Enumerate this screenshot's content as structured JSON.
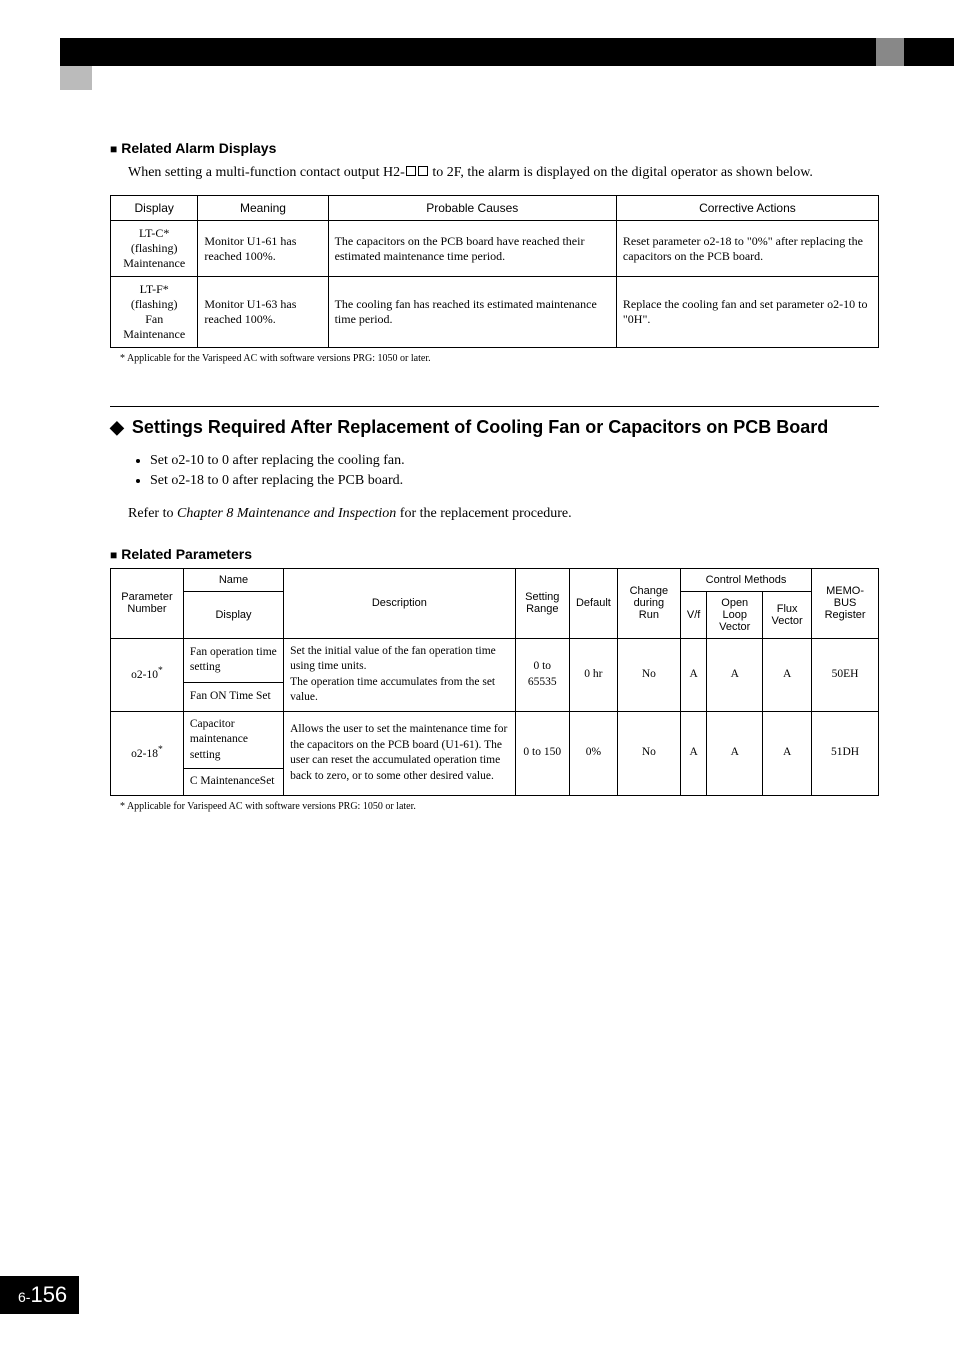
{
  "section1": {
    "heading": "Related Alarm Displays",
    "intro_a": "When setting a multi-function contact output H2-",
    "intro_b": " to 2F, the alarm is displayed on the digital operator as shown below.",
    "table": {
      "headers": [
        "Display",
        "Meaning",
        "Probable Causes",
        "Corrective Actions"
      ],
      "rows": [
        {
          "display_l1": "LT-C*",
          "display_l2": "(flashing)",
          "display_l3": "Maintenance",
          "meaning": "Monitor U1-61 has reached 100%.",
          "causes": "The capacitors on the PCB board have reached their estimated maintenance time period.",
          "actions": "Reset parameter o2-18 to \"0%\" after replacing the capacitors on the PCB board."
        },
        {
          "display_l1": "LT-F*",
          "display_l2": "(flashing)",
          "display_l3": "Fan Maintenance",
          "meaning": "Monitor U1-63 has reached 100%.",
          "causes": "The cooling fan has reached its estimated maintenance time period.",
          "actions": "Replace the cooling fan and set parameter o2-10 to \"0H\"."
        }
      ]
    },
    "footnote": "*   Applicable for the Varispeed AC with software versions PRG: 1050 or later."
  },
  "section2": {
    "heading": "Settings Required After Replacement of Cooling Fan or Capacitors on PCB Board",
    "bullets": [
      "Set o2-10 to 0 after replacing the cooling fan.",
      "Set o2-18 to 0 after replacing the PCB board."
    ],
    "ref_a": "Refer to ",
    "ref_i": "Chapter 8 Maintenance and Inspection",
    "ref_b": " for the replacement procedure."
  },
  "section3": {
    "heading": "Related Parameters",
    "headers": {
      "param": "Parameter Number",
      "name": "Name",
      "display": "Display",
      "desc": "Description",
      "range": "Setting Range",
      "default": "Default",
      "change": "Change during Run",
      "control": "Control Methods",
      "vf": "V/f",
      "olv": "Open Loop Vector",
      "flux": "Flux Vector",
      "memo": "MEMO-BUS Register"
    },
    "rows": [
      {
        "param": "o2-10",
        "star": "*",
        "name": "Fan operation time setting",
        "display": "Fan ON Time Set",
        "desc": "Set the initial value of the fan operation time using time units.\nThe operation time accumulates from the set value.",
        "range": "0 to 65535",
        "default": "0 hr",
        "change": "No",
        "vf": "A",
        "olv": "A",
        "flux": "A",
        "memo": "50EH"
      },
      {
        "param": "o2-18",
        "star": "*",
        "name": "Capacitor maintenance setting",
        "display": "C MaintenanceSet",
        "desc": "Allows the user to set the maintenance time for the capacitors on the PCB board (U1-61). The user can reset the accumulated operation time back to zero, or to some other desired value.",
        "range": "0 to 150",
        "default": "0%",
        "change": "No",
        "vf": "A",
        "olv": "A",
        "flux": "A",
        "memo": "51DH"
      }
    ],
    "footnote": "*   Applicable for Varispeed AC with software versions PRG: 1050 or later."
  },
  "page": {
    "prefix": "6-",
    "num": "156"
  }
}
